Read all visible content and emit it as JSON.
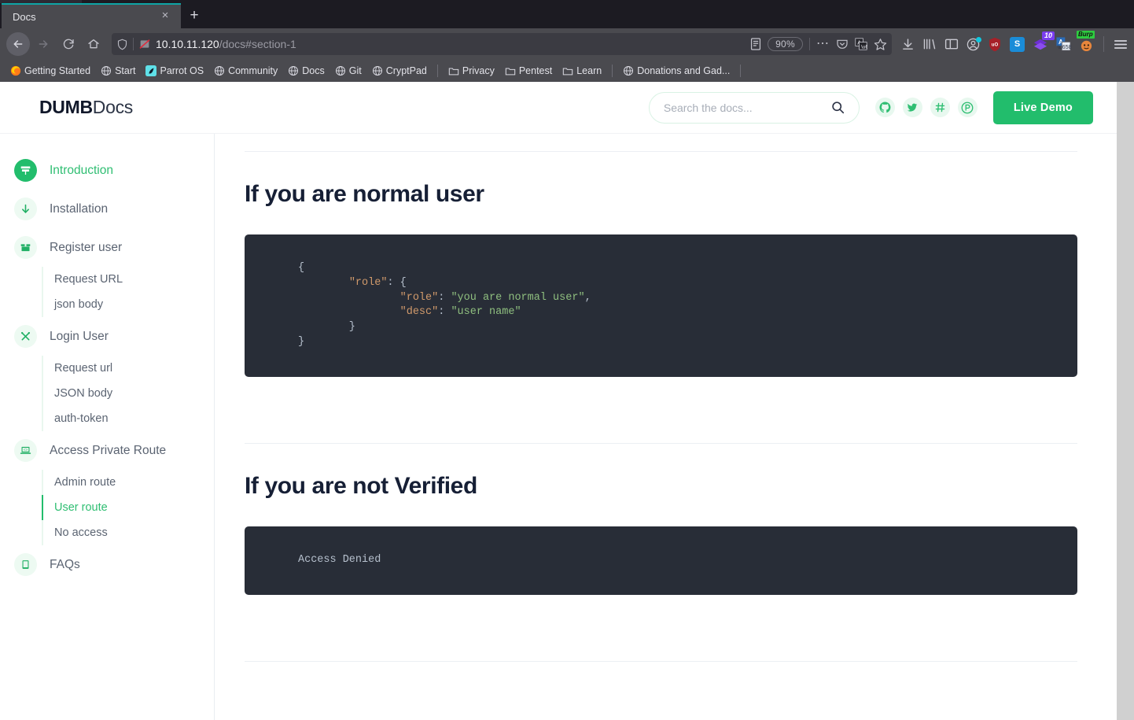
{
  "browser": {
    "tab": {
      "title": "Docs",
      "close_label": "×"
    },
    "newtab_label": "+",
    "url": {
      "host": "10.10.11.120",
      "path": "/docs#section-1",
      "full": "10.10.11.120/docs#section-1"
    },
    "zoom_level": "90%",
    "bookmarks": [
      {
        "label": "Getting Started",
        "icon": "firefox-icon"
      },
      {
        "label": "Start",
        "icon": "globe-icon"
      },
      {
        "label": "Parrot OS",
        "icon": "parrot-icon"
      },
      {
        "label": "Community",
        "icon": "globe-icon"
      },
      {
        "label": "Docs",
        "icon": "globe-icon"
      },
      {
        "label": "Git",
        "icon": "globe-icon"
      },
      {
        "label": "CryptPad",
        "icon": "globe-icon"
      },
      {
        "label": "Privacy",
        "icon": "folder-icon"
      },
      {
        "label": "Pentest",
        "icon": "folder-icon"
      },
      {
        "label": "Learn",
        "icon": "folder-icon"
      },
      {
        "label": "Donations and Gad...",
        "icon": "globe-icon"
      }
    ],
    "extensions": [
      {
        "name": "ublock-origin",
        "label": "uO",
        "color": "#b9232c"
      },
      {
        "name": "stylus",
        "label": "S",
        "color": "#1a8cd8"
      },
      {
        "name": "layers-extension",
        "label": "",
        "color": "#6a2fd0",
        "badge": "10"
      },
      {
        "name": "translate-extension",
        "label": "A",
        "color": "#2b6cb8"
      },
      {
        "name": "burp-suite",
        "label": "",
        "color": "#e07b39",
        "badge": "Burp"
      }
    ]
  },
  "header": {
    "logo_bold": "DUMB",
    "logo_light": "Docs",
    "search": {
      "placeholder": "Search the docs...",
      "value": ""
    },
    "socials": [
      {
        "name": "github-icon",
        "glyph": ""
      },
      {
        "name": "twitter-icon",
        "glyph": ""
      },
      {
        "name": "slack-icon",
        "glyph": "#"
      },
      {
        "name": "product-hunt-icon",
        "glyph": "P"
      }
    ],
    "live_demo_label": "Live Demo"
  },
  "sidebar": {
    "items": [
      {
        "label": "Introduction",
        "icon": "signpost-icon",
        "active": true,
        "children": []
      },
      {
        "label": "Installation",
        "icon": "download-arrow-icon",
        "active": false,
        "children": []
      },
      {
        "label": "Register user",
        "icon": "package-box-icon",
        "active": false,
        "children": [
          {
            "label": "Request URL",
            "active": false
          },
          {
            "label": "json body",
            "active": false
          }
        ]
      },
      {
        "label": "Login User",
        "icon": "tools-icon",
        "active": false,
        "children": [
          {
            "label": "Request url",
            "active": false
          },
          {
            "label": "JSON body",
            "active": false
          },
          {
            "label": "auth-token",
            "active": false
          }
        ]
      },
      {
        "label": "Access Private Route",
        "icon": "laptop-code-icon",
        "active": false,
        "children": [
          {
            "label": "Admin route",
            "active": false
          },
          {
            "label": "User route",
            "active": true
          },
          {
            "label": "No access",
            "active": false
          }
        ]
      },
      {
        "label": "FAQs",
        "icon": "tablet-icon",
        "active": false,
        "children": []
      }
    ]
  },
  "content": {
    "sections": [
      {
        "heading": "If you are normal user",
        "code_lines": [
          [
            {
              "t": "{",
              "c": "p"
            }
          ],
          [
            {
              "t": "        ",
              "c": "p"
            },
            {
              "t": "\"role\"",
              "c": "k"
            },
            {
              "t": ": {",
              "c": "p"
            }
          ],
          [
            {
              "t": "                ",
              "c": "p"
            },
            {
              "t": "\"role\"",
              "c": "k"
            },
            {
              "t": ": ",
              "c": "p"
            },
            {
              "t": "\"you are normal user\"",
              "c": "s"
            },
            {
              "t": ",",
              "c": "p"
            }
          ],
          [
            {
              "t": "                ",
              "c": "p"
            },
            {
              "t": "\"desc\"",
              "c": "k"
            },
            {
              "t": ": ",
              "c": "p"
            },
            {
              "t": "\"user name\"",
              "c": "s"
            }
          ],
          [
            {
              "t": "        }",
              "c": "p"
            }
          ],
          [
            {
              "t": "}",
              "c": "p"
            }
          ]
        ]
      },
      {
        "heading": "If you are not Verified",
        "code_lines": [
          [
            {
              "t": "Access Denied",
              "c": "p"
            }
          ]
        ]
      }
    ]
  },
  "colors": {
    "accent_green": "#22bd6c",
    "code_bg": "#282d37",
    "heading": "#161f35",
    "chrome_bg": "#4a4a4f"
  }
}
